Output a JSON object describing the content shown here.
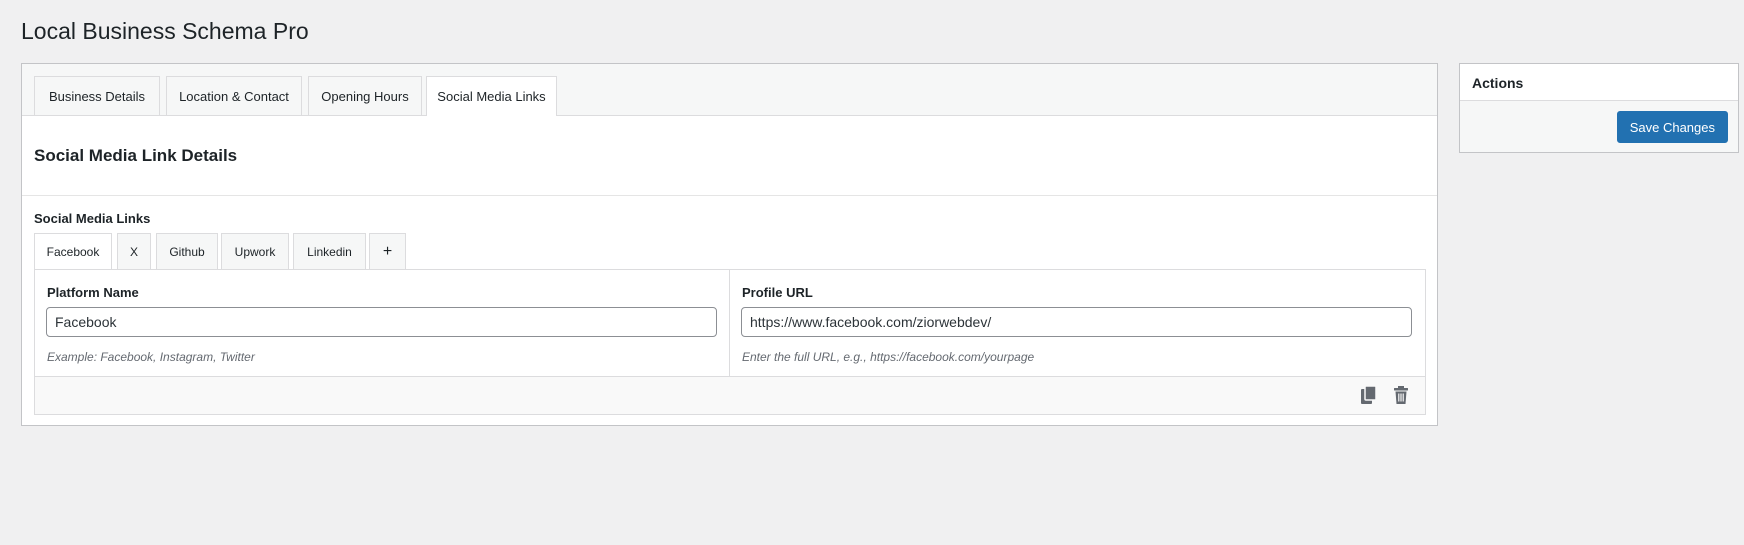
{
  "page": {
    "title": "Local Business Schema Pro"
  },
  "tabs": [
    {
      "label": "Business Details"
    },
    {
      "label": "Location & Contact"
    },
    {
      "label": "Opening Hours"
    },
    {
      "label": "Social Media Links",
      "active": true
    }
  ],
  "section": {
    "title": "Social Media Link Details",
    "field_label": "Social Media Links"
  },
  "social_tabs": [
    {
      "label": "Facebook",
      "active": true
    },
    {
      "label": "X"
    },
    {
      "label": "Github"
    },
    {
      "label": "Upwork"
    },
    {
      "label": "Linkedin"
    },
    {
      "label": "+"
    }
  ],
  "repeater": {
    "platform_label": "Platform Name",
    "platform_value": "Facebook",
    "platform_desc": "Example: Facebook, Instagram, Twitter",
    "url_label": "Profile URL",
    "url_value": "https://www.facebook.com/ziorwebdev/",
    "url_desc": "Enter the full URL, e.g., https://facebook.com/yourpage",
    "icons": [
      "copy-icon",
      "trash-icon"
    ]
  },
  "actions": {
    "title": "Actions",
    "save_label": "Save Changes"
  },
  "colors": {
    "primary": "#2271b1",
    "background": "#f0f0f1",
    "icon_gray": "#646970"
  }
}
